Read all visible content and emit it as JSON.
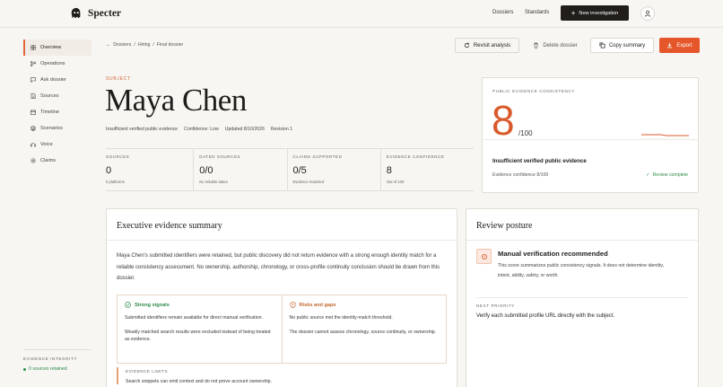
{
  "app": {
    "name": "Specter"
  },
  "topnav": {
    "links": [
      "Dossiers",
      "Standards"
    ],
    "new_button": "New investigation"
  },
  "sidebar": {
    "items": [
      {
        "label": "Overview",
        "icon": "grid-icon",
        "active": true
      },
      {
        "label": "Operations",
        "icon": "branch-icon"
      },
      {
        "label": "Ask dossier",
        "icon": "chat-icon"
      },
      {
        "label": "Sources",
        "icon": "document-icon"
      },
      {
        "label": "Timeline",
        "icon": "calendar-icon"
      },
      {
        "label": "Scenarios",
        "icon": "layers-icon"
      },
      {
        "label": "Voice",
        "icon": "headphones-icon"
      },
      {
        "label": "Claims",
        "icon": "gear-icon"
      }
    ],
    "footer": {
      "label": "EVIDENCE INTEGRITY",
      "value": "0 sources retained"
    }
  },
  "breadcrumb": {
    "items": [
      "Dossiers",
      "Hiring",
      "Final dossier"
    ]
  },
  "actions": {
    "revisit": "Revisit analysis",
    "delete": "Delete dossier",
    "copy": "Copy summary",
    "export": "Export"
  },
  "subject": {
    "label": "SUBJECT",
    "name": "Maya Chen",
    "meta": [
      "Insufficient verified public evidence",
      "Confidence: Low",
      "Updated 8/10/2026",
      "Revision 1"
    ]
  },
  "stats": [
    {
      "label": "SOURCES",
      "value": "0",
      "sub": "0 platforms"
    },
    {
      "label": "DATED SOURCES",
      "value": "0/0",
      "sub": "No reliable dates"
    },
    {
      "label": "CLAIMS SUPPORTED",
      "value": "0/5",
      "sub": "Evidence matched"
    },
    {
      "label": "EVIDENCE CONFIDENCE",
      "value": "8",
      "sub": "Out of 100"
    }
  ],
  "score": {
    "label": "PUBLIC EVIDENCE CONSISTENCY",
    "value": "8",
    "max": "/100",
    "status": "Insufficient verified public evidence",
    "confidence": "Evidence confidence 8/100",
    "complete": "Review complete",
    "accent": "#d95a2b"
  },
  "executive": {
    "title": "Executive evidence summary",
    "body": "Maya Chen's submitted identifiers were retained, but public discovery did not return evidence with a strong enough identity match for a reliable consistency assessment. No ownership, authorship, chronology, or cross-profile continuity conclusion should be drawn from this dossier.",
    "strong": {
      "title": "Strong signals",
      "lines": [
        "Submitted identifiers remain available for direct manual verification.",
        "Weakly matched search results were excluded instead of being treated as evidence."
      ]
    },
    "risks": {
      "title": "Risks and gaps",
      "lines": [
        "No public source met the identity-match threshold.",
        "The dossier cannot assess chronology, source continuity, or ownership."
      ]
    },
    "limits": {
      "label": "EVIDENCE LIMITS",
      "text": "Search snippets can omit context and do not prove account ownership."
    }
  },
  "review": {
    "title": "Review posture",
    "heading": "Manual verification recommended",
    "description": "This score summarizes public consistency signals. It does not determine identity, intent, ability, safety, or worth.",
    "priority_label": "NEXT PRIORITY",
    "priority": "Verify each submitted profile URL directly with the subject."
  }
}
